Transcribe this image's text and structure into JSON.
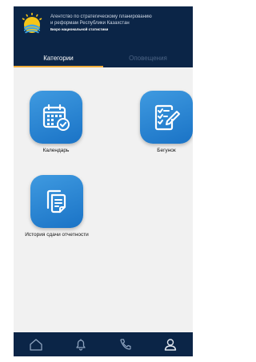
{
  "header": {
    "agency_line1": "Агентство по стратегическому планированию",
    "agency_line2": "и реформам Республики Казахстан",
    "agency_line3": "Бюро национальной статистики"
  },
  "tabs": [
    {
      "label": "Категории",
      "active": true
    },
    {
      "label": "Оповещения",
      "active": false
    }
  ],
  "tiles": [
    {
      "label": "Календарь",
      "icon": "calendar-check-icon"
    },
    {
      "label": "Бегунок",
      "icon": "checklist-edit-icon"
    },
    {
      "label": "История сдачи отчетности",
      "icon": "documents-icon"
    }
  ],
  "bottom_nav": [
    {
      "icon": "home-icon"
    },
    {
      "icon": "bell-icon"
    },
    {
      "icon": "phone-icon"
    },
    {
      "icon": "user-icon"
    }
  ],
  "colors": {
    "header_bg": "#0b2547",
    "accent_underline": "#f0ad3c",
    "tile_blue": "#2a86d6",
    "screen_bg": "#f1f1f1"
  }
}
